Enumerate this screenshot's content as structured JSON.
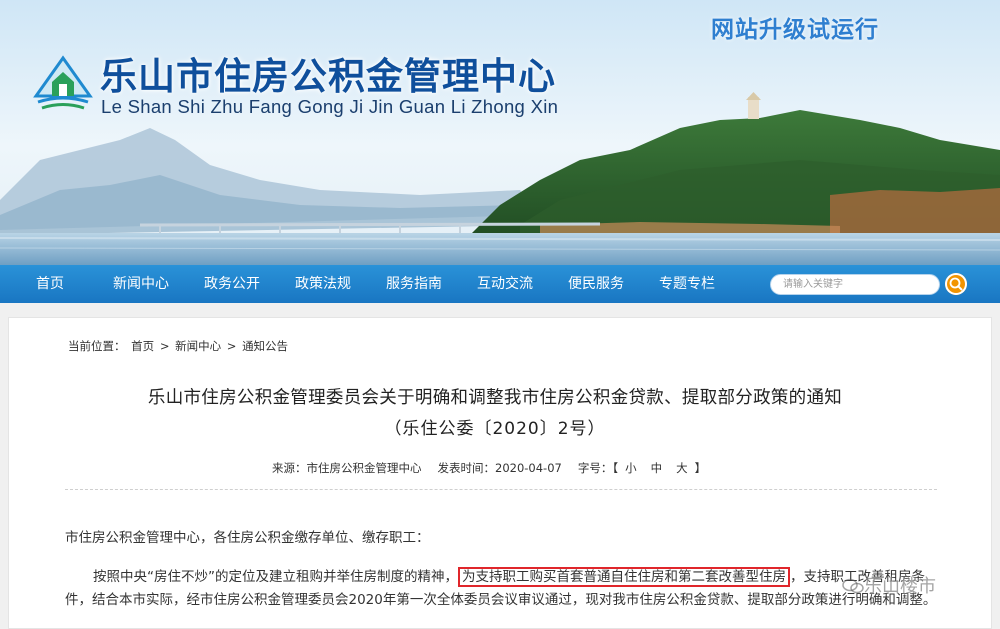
{
  "site": {
    "title": "乐山市住房公积金管理中心",
    "pinyin": "Le Shan Shi Zhu Fang Gong Ji Jin Guan Li Zhong Xin",
    "upgrade_notice": "网站升级试运行"
  },
  "nav": {
    "items": [
      "首页",
      "新闻中心",
      "政务公开",
      "政策法规",
      "服务指南",
      "互动交流",
      "便民服务",
      "专题专栏"
    ]
  },
  "search": {
    "placeholder": "请输入关键字"
  },
  "breadcrumb": {
    "prefix": "当前位置：",
    "items": [
      "首页",
      "新闻中心",
      "通知公告"
    ],
    "separator": ">"
  },
  "article": {
    "title": "乐山市住房公积金管理委员会关于明确和调整我市住房公积金贷款、提取部分政策的通知",
    "doc_number": "（乐住公委〔2020〕2号）",
    "source_label": "来源：",
    "source": "市住房公积金管理中心",
    "date_label": "发表时间：",
    "date": "2020-04-07",
    "font_size_label": "字号：",
    "font_sizes": [
      "小",
      "中",
      "大"
    ],
    "salutation": "市住房公积金管理中心，各住房公积金缴存单位、缴存职工：",
    "para1_before": "按照中央“房住不炒”的定位及建立租购并举住房制度的精神，",
    "para1_highlight": "为支持职工购买首套普通自住住房和第二套改善型住房",
    "para1_after": "，支持职工改善租房条件，结合本市实际，经市住房公积金管理委员会2020年第一次全体委员会议审议通过，现对我市住房公积金贷款、提取部分政策进行明确和调整。"
  },
  "watermark": {
    "text": "乐山楼市"
  },
  "colors": {
    "nav_bg": "#1e82cc",
    "title_blue": "#0f4f9c",
    "highlight_red": "#e0262b",
    "search_orange": "#f29400"
  }
}
